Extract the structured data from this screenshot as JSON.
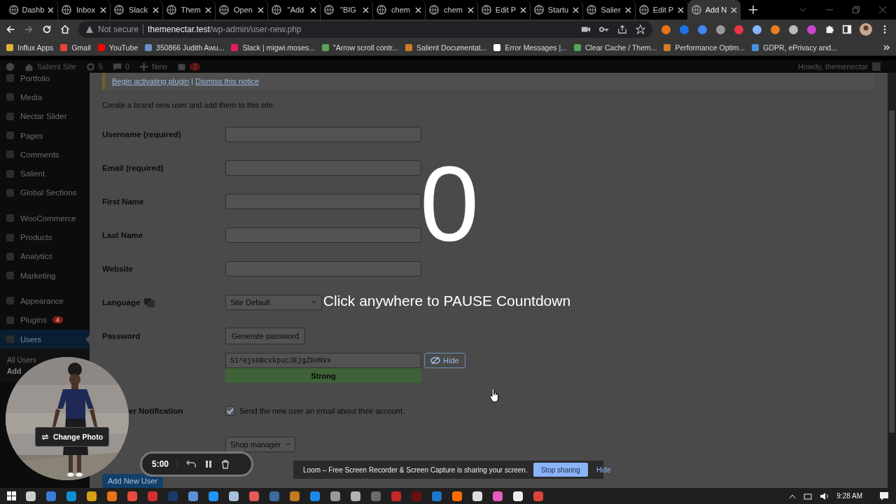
{
  "tabs": [
    {
      "title": "Dashb",
      "selected": false
    },
    {
      "title": "Inbox",
      "selected": false
    },
    {
      "title": "Slack",
      "selected": false
    },
    {
      "title": "Them",
      "selected": false
    },
    {
      "title": "Open",
      "selected": false
    },
    {
      "title": "\"Add",
      "selected": false
    },
    {
      "title": "\"BIG",
      "selected": false
    },
    {
      "title": "chem",
      "selected": false
    },
    {
      "title": "chem",
      "selected": false
    },
    {
      "title": "Edit P",
      "selected": false
    },
    {
      "title": "Startu",
      "selected": false
    },
    {
      "title": "Salier",
      "selected": false
    },
    {
      "title": "Edit P",
      "selected": false
    },
    {
      "title": "Add N",
      "selected": true
    }
  ],
  "address": {
    "security": "Not secure",
    "host": "themenectar.test",
    "path": "/wp-admin/user-new.php"
  },
  "bookmarks": [
    "Influx Apps",
    "Gmail",
    "YouTube",
    "350866 Judith Awu...",
    "Slack | migwi.moses...",
    "\"Arrow scroll contr...",
    "Salient Documentat...",
    "Error Messages |...",
    "Clear Cache / Them...",
    "Performance Optim...",
    "GDPR, ePrivacy and..."
  ],
  "admin_bar": {
    "site": "Salient Site",
    "updates": "5",
    "comments": "0",
    "new": "New",
    "seo_count": "2",
    "howdy": "Howdy, themenectar"
  },
  "sidebar": {
    "groups": [
      [
        {
          "label": "Portfolio",
          "selected": false
        },
        {
          "label": "Media",
          "selected": false
        },
        {
          "label": "Nectar Slider",
          "selected": false
        },
        {
          "label": "Pages",
          "selected": false
        },
        {
          "label": "Comments",
          "selected": false
        },
        {
          "label": "Salient",
          "selected": false
        },
        {
          "label": "Global Sections",
          "selected": false
        }
      ],
      [
        {
          "label": "WooCommerce",
          "selected": false
        },
        {
          "label": "Products",
          "selected": false
        },
        {
          "label": "Analytics",
          "selected": false
        },
        {
          "label": "Marketing",
          "selected": false
        }
      ],
      [
        {
          "label": "Appearance",
          "selected": false
        },
        {
          "label": "Plugins",
          "badge": "4",
          "selected": false
        },
        {
          "label": "Users",
          "selected": true
        }
      ]
    ],
    "submenu": [
      {
        "label": "All Users",
        "selected": false
      },
      {
        "label": "Add",
        "selected": true
      }
    ]
  },
  "notice": {
    "links": [
      "Begin activating plugin",
      "Dismiss this notice"
    ],
    "separator": "|"
  },
  "description": "Create a brand new user and add them to this site.",
  "form": [
    {
      "kind": "text",
      "label": "Username (required)"
    },
    {
      "kind": "text",
      "label": "Email (required)"
    },
    {
      "kind": "text",
      "label": "First Name"
    },
    {
      "kind": "text",
      "label": "Last Name"
    },
    {
      "kind": "text",
      "label": "Website"
    },
    {
      "kind": "select",
      "label": "Language",
      "value": "Site Default"
    },
    {
      "kind": "button",
      "label": "Password",
      "button": "Generate password"
    },
    {
      "kind": "password",
      "value": "S1^ejs08cxkpucJEjgZD#NVx",
      "toggle": "Hide",
      "strength": "Strong"
    },
    {
      "kind": "checkbox",
      "label": "er Notification",
      "text": "Send the new user an email about their account.",
      "checked": true
    },
    {
      "kind": "select",
      "value": "Shop manager"
    }
  ],
  "submit": "Add New User",
  "countdown": {
    "number": "0",
    "hint": "Click anywhere to PAUSE Countdown"
  },
  "camera": {
    "button": "Change Photo"
  },
  "recorder": {
    "time": "5:00"
  },
  "share_bar": {
    "message": "Loom – Free Screen Recorder & Screen Capture is sharing your screen.",
    "stop": "Stop sharing",
    "hide": "Hide"
  },
  "clock": "9:28 AM"
}
